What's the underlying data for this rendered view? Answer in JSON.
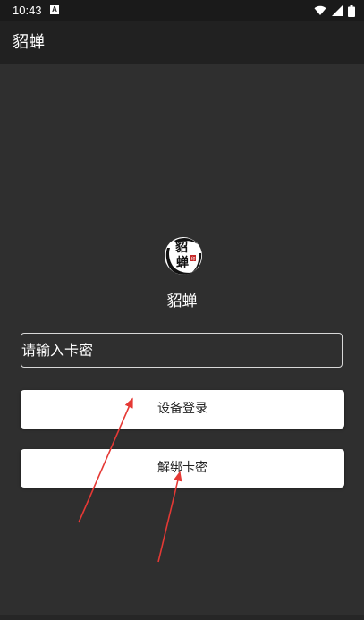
{
  "status_bar": {
    "time": "10:43",
    "notification_letter": "A",
    "icons": [
      "wifi-icon",
      "signal-icon",
      "battery-icon"
    ]
  },
  "app_bar": {
    "title": "貂蝉"
  },
  "logo": {
    "chars": [
      "貂",
      "蝉"
    ],
    "seal": "印"
  },
  "main": {
    "app_name": "貂蝉",
    "card_input": {
      "placeholder": "请输入卡密",
      "value": ""
    },
    "login_button": "设备登录",
    "unbind_button": "解绑卡密"
  },
  "colors": {
    "background": "#2f2f2f",
    "app_bar": "#212121",
    "status_bar": "#1a1a1a",
    "button": "#ffffff",
    "annotation_arrow": "#e53935"
  }
}
